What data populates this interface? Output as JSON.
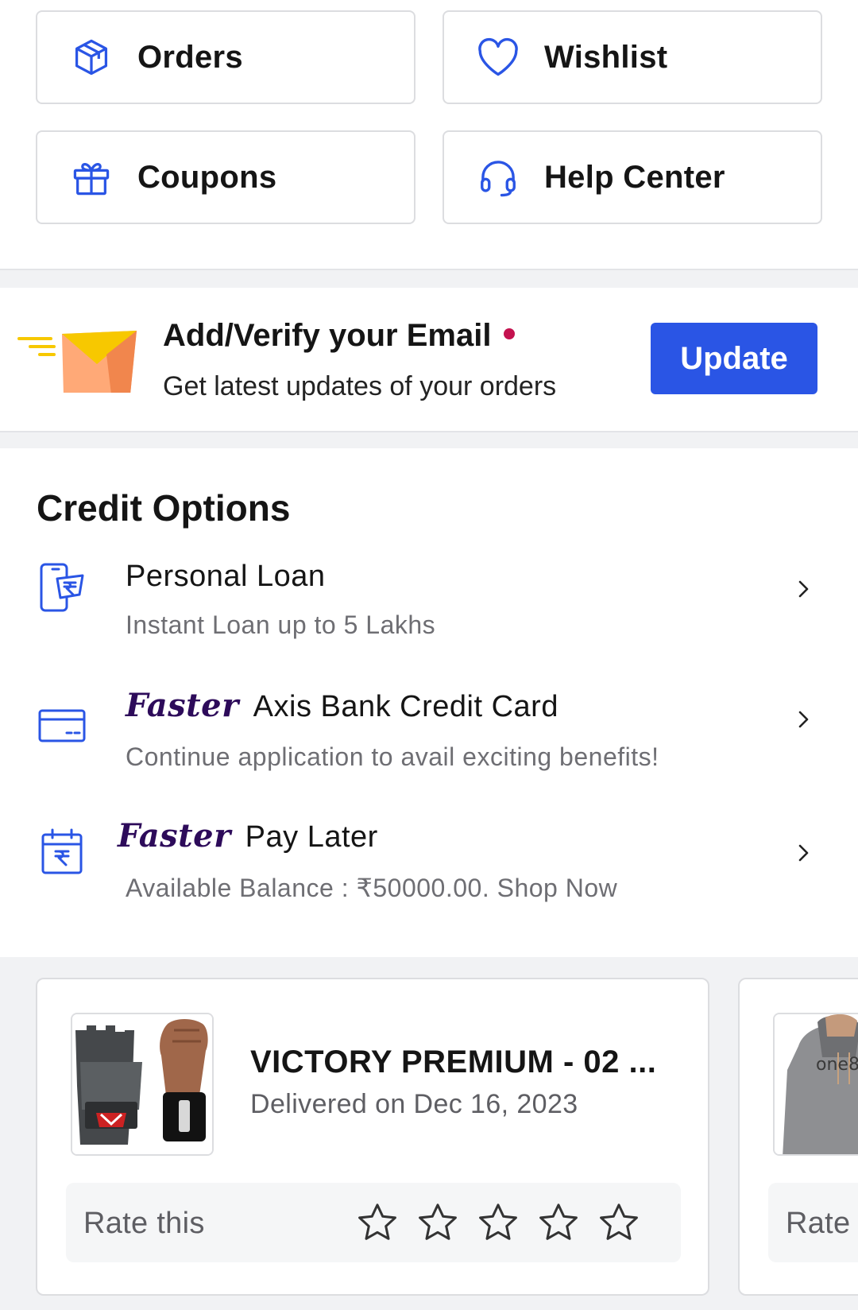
{
  "quick_actions": {
    "orders": {
      "label": "Orders",
      "icon": "package-icon"
    },
    "wishlist": {
      "label": "Wishlist",
      "icon": "heart-icon"
    },
    "coupons": {
      "label": "Coupons",
      "icon": "gift-icon"
    },
    "help": {
      "label": "Help Center",
      "icon": "headset-icon"
    }
  },
  "email_banner": {
    "title": "Add/Verify your Email",
    "subtitle": "Get latest updates of your orders",
    "button": "Update",
    "colors": {
      "button": "#2a55e5",
      "dot": "#c4124f"
    }
  },
  "credit": {
    "title": "Credit Options",
    "items": [
      {
        "title": "Personal Loan",
        "subtitle": "Instant Loan up to 5 Lakhs",
        "icon": "phone-rupee-icon"
      },
      {
        "badge": "Faster",
        "title": "Axis Bank Credit Card",
        "subtitle": "Continue application to avail exciting benefits!",
        "icon": "credit-card-icon"
      },
      {
        "badge": "Faster",
        "title": "Pay Later",
        "subtitle": "Available Balance : ₹50000.00. Shop Now",
        "icon": "calendar-rupee-icon"
      }
    ]
  },
  "recent_orders": [
    {
      "name": "VICTORY PREMIUM - 02 ...",
      "status": "Delivered on Dec 16, 2023",
      "rate_label": "Rate this",
      "stars": 0,
      "max_stars": 5
    },
    {
      "thumb_text": "one8",
      "rate_label": "Rate this"
    }
  ]
}
